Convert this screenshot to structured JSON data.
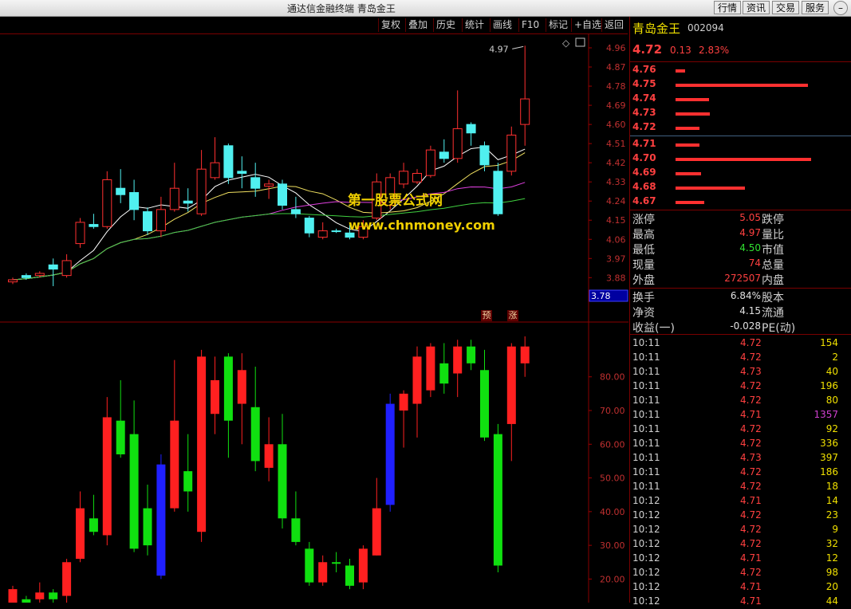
{
  "window": {
    "title": "通达信金融终端  青岛金王",
    "buttons": [
      "行情",
      "资讯",
      "交易",
      "服务"
    ]
  },
  "toolbar": {
    "items": [
      "复权",
      "叠加",
      "历史",
      "统计",
      "画线",
      "F10",
      "标记",
      "+自选",
      "返回"
    ]
  },
  "chart_data": [
    {
      "type": "candlestick",
      "ylabels": [
        "4.96",
        "4.87",
        "4.78",
        "4.69",
        "4.60",
        "4.51",
        "4.42",
        "4.33",
        "4.24",
        "4.15",
        "4.06",
        "3.97",
        "3.88"
      ],
      "ylim": [
        3.78,
        4.99
      ],
      "current_price_label": "3.78",
      "high_annotation": "4.97",
      "candles": [
        {
          "o": 3.86,
          "c": 3.87,
          "h": 3.88,
          "l": 3.85,
          "up": true
        },
        {
          "o": 3.89,
          "c": 3.88,
          "h": 3.9,
          "l": 3.87,
          "up": false
        },
        {
          "o": 3.89,
          "c": 3.9,
          "h": 3.91,
          "l": 3.88,
          "up": true
        },
        {
          "o": 3.94,
          "c": 3.92,
          "h": 3.97,
          "l": 3.84,
          "up": false
        },
        {
          "o": 3.89,
          "c": 3.96,
          "h": 3.99,
          "l": 3.88,
          "up": true
        },
        {
          "o": 4.04,
          "c": 4.14,
          "h": 4.16,
          "l": 4.02,
          "up": true
        },
        {
          "o": 4.13,
          "c": 4.12,
          "h": 4.18,
          "l": 4.11,
          "up": false
        },
        {
          "o": 4.12,
          "c": 4.34,
          "h": 4.38,
          "l": 4.11,
          "up": true
        },
        {
          "o": 4.3,
          "c": 4.27,
          "h": 4.39,
          "l": 4.23,
          "up": false
        },
        {
          "o": 4.28,
          "c": 4.2,
          "h": 4.34,
          "l": 4.15,
          "up": false
        },
        {
          "o": 4.19,
          "c": 4.1,
          "h": 4.21,
          "l": 4.08,
          "up": false
        },
        {
          "o": 4.1,
          "c": 4.2,
          "h": 4.26,
          "l": 4.07,
          "up": true
        },
        {
          "o": 4.2,
          "c": 4.3,
          "h": 4.42,
          "l": 4.19,
          "up": true
        },
        {
          "o": 4.24,
          "c": 4.23,
          "h": 4.3,
          "l": 4.19,
          "up": false
        },
        {
          "o": 4.18,
          "c": 4.39,
          "h": 4.48,
          "l": 4.17,
          "up": true
        },
        {
          "o": 4.35,
          "c": 4.42,
          "h": 4.54,
          "l": 4.34,
          "up": true
        },
        {
          "o": 4.5,
          "c": 4.35,
          "h": 4.51,
          "l": 4.32,
          "up": false
        },
        {
          "o": 4.38,
          "c": 4.37,
          "h": 4.45,
          "l": 4.3,
          "up": false
        },
        {
          "o": 4.35,
          "c": 4.3,
          "h": 4.42,
          "l": 4.26,
          "up": false
        },
        {
          "o": 4.31,
          "c": 4.32,
          "h": 4.34,
          "l": 4.25,
          "up": true
        },
        {
          "o": 4.32,
          "c": 4.22,
          "h": 4.34,
          "l": 4.2,
          "up": false
        },
        {
          "o": 4.2,
          "c": 4.18,
          "h": 4.26,
          "l": 4.16,
          "up": false
        },
        {
          "o": 4.16,
          "c": 4.09,
          "h": 4.17,
          "l": 4.07,
          "up": false
        },
        {
          "o": 4.07,
          "c": 4.1,
          "h": 4.14,
          "l": 4.06,
          "up": true
        },
        {
          "o": 4.1,
          "c": 4.1,
          "h": 4.11,
          "l": 4.09,
          "up": false
        },
        {
          "o": 4.09,
          "c": 4.07,
          "h": 4.13,
          "l": 4.06,
          "up": false
        },
        {
          "o": 4.07,
          "c": 4.12,
          "h": 4.15,
          "l": 4.06,
          "up": true
        },
        {
          "o": 4.16,
          "c": 4.33,
          "h": 4.37,
          "l": 4.15,
          "up": true
        },
        {
          "o": 4.22,
          "c": 4.35,
          "h": 4.37,
          "l": 4.2,
          "up": true
        },
        {
          "o": 4.32,
          "c": 4.38,
          "h": 4.42,
          "l": 4.3,
          "up": true
        },
        {
          "o": 4.33,
          "c": 4.37,
          "h": 4.39,
          "l": 4.32,
          "up": true
        },
        {
          "o": 4.36,
          "c": 4.48,
          "h": 4.5,
          "l": 4.35,
          "up": true
        },
        {
          "o": 4.47,
          "c": 4.44,
          "h": 4.53,
          "l": 4.42,
          "up": false
        },
        {
          "o": 4.44,
          "c": 4.58,
          "h": 4.76,
          "l": 4.42,
          "up": true
        },
        {
          "o": 4.6,
          "c": 4.56,
          "h": 4.61,
          "l": 4.5,
          "up": false
        },
        {
          "o": 4.5,
          "c": 4.41,
          "h": 4.52,
          "l": 4.38,
          "up": false
        },
        {
          "o": 4.38,
          "c": 4.18,
          "h": 4.42,
          "l": 4.17,
          "up": false
        },
        {
          "o": 4.38,
          "c": 4.55,
          "h": 4.59,
          "l": 4.36,
          "up": true
        },
        {
          "o": 4.6,
          "c": 4.72,
          "h": 4.97,
          "l": 4.5,
          "up": true
        }
      ]
    },
    {
      "type": "bar",
      "ylabels": [
        "80.00",
        "70.00",
        "60.00",
        "50.00",
        "40.00",
        "30.00",
        "20.00"
      ],
      "ylim": [
        13,
        92
      ],
      "bars": [
        {
          "o": 13,
          "c": 17,
          "h": 18,
          "l": 12,
          "color": "red"
        },
        {
          "o": 14,
          "c": 13,
          "h": 15,
          "l": 12,
          "color": "green"
        },
        {
          "o": 14,
          "c": 16,
          "h": 19,
          "l": 13,
          "color": "red"
        },
        {
          "o": 16,
          "c": 14,
          "h": 17,
          "l": 13,
          "color": "green"
        },
        {
          "o": 15,
          "c": 25,
          "h": 26,
          "l": 13,
          "color": "red"
        },
        {
          "o": 26,
          "c": 41,
          "h": 46,
          "l": 25,
          "color": "red"
        },
        {
          "o": 38,
          "c": 34,
          "h": 45,
          "l": 33,
          "color": "green"
        },
        {
          "o": 33,
          "c": 68,
          "h": 74,
          "l": 30,
          "color": "red"
        },
        {
          "o": 67,
          "c": 57,
          "h": 79,
          "l": 56,
          "color": "green"
        },
        {
          "o": 63,
          "c": 29,
          "h": 73,
          "l": 28,
          "color": "green"
        },
        {
          "o": 41,
          "c": 30,
          "h": 48,
          "l": 27,
          "color": "green"
        },
        {
          "o": 54,
          "c": 21,
          "h": 57,
          "l": 20,
          "color": "blue"
        },
        {
          "o": 41,
          "c": 67,
          "h": 85,
          "l": 40,
          "color": "red"
        },
        {
          "o": 52,
          "c": 46,
          "h": 63,
          "l": 40,
          "color": "green"
        },
        {
          "o": 34,
          "c": 86,
          "h": 88,
          "l": 31,
          "color": "red"
        },
        {
          "o": 69,
          "c": 79,
          "h": 86,
          "l": 63,
          "color": "red"
        },
        {
          "o": 86,
          "c": 67,
          "h": 87,
          "l": 56,
          "color": "green"
        },
        {
          "o": 82,
          "c": 72,
          "h": 87,
          "l": 60,
          "color": "red"
        },
        {
          "o": 71,
          "c": 55,
          "h": 83,
          "l": 52,
          "color": "green"
        },
        {
          "o": 53,
          "c": 60,
          "h": 68,
          "l": 49,
          "color": "red"
        },
        {
          "o": 60,
          "c": 38,
          "h": 69,
          "l": 35,
          "color": "green"
        },
        {
          "o": 38,
          "c": 31,
          "h": 46,
          "l": 30,
          "color": "green"
        },
        {
          "o": 29,
          "c": 19,
          "h": 31,
          "l": 18,
          "color": "green"
        },
        {
          "o": 19,
          "c": 25,
          "h": 27,
          "l": 18,
          "color": "red"
        },
        {
          "o": 25,
          "c": 25,
          "h": 28,
          "l": 22,
          "color": "green"
        },
        {
          "o": 24,
          "c": 18,
          "h": 26,
          "l": 17,
          "color": "green"
        },
        {
          "o": 19,
          "c": 29,
          "h": 30,
          "l": 17,
          "color": "red"
        },
        {
          "o": 27,
          "c": 41,
          "h": 50,
          "l": 27,
          "color": "red"
        },
        {
          "o": 42,
          "c": 72,
          "h": 75,
          "l": 40,
          "color": "blue"
        },
        {
          "o": 70,
          "c": 75,
          "h": 76,
          "l": 59,
          "color": "red"
        },
        {
          "o": 72,
          "c": 86,
          "h": 89,
          "l": 62,
          "color": "red"
        },
        {
          "o": 76,
          "c": 89,
          "h": 90,
          "l": 74,
          "color": "red"
        },
        {
          "o": 84,
          "c": 78,
          "h": 90,
          "l": 75,
          "color": "green"
        },
        {
          "o": 81,
          "c": 89,
          "h": 91,
          "l": 74,
          "color": "red"
        },
        {
          "o": 89,
          "c": 84,
          "h": 91,
          "l": 82,
          "color": "green"
        },
        {
          "o": 82,
          "c": 62,
          "h": 88,
          "l": 61,
          "color": "green"
        },
        {
          "o": 63,
          "c": 24,
          "h": 66,
          "l": 22,
          "color": "green"
        },
        {
          "o": 66,
          "c": 89,
          "h": 90,
          "l": 55,
          "color": "red"
        },
        {
          "o": 89,
          "c": 84,
          "h": 92,
          "l": 80,
          "color": "red"
        }
      ]
    }
  ],
  "markers": {
    "yu": "预",
    "zhang": "涨"
  },
  "watermark": {
    "line1": "第一股票公式网",
    "line2": "www.chnmoney.com"
  },
  "quote": {
    "name": "青岛金王",
    "code": "002094",
    "price": "4.72",
    "change": "0.13",
    "change_pct": "2.83%"
  },
  "order_book": {
    "asks": [
      {
        "price": "4.76",
        "vol": 6
      },
      {
        "price": "4.75",
        "vol": 84
      },
      {
        "price": "4.74",
        "vol": 21
      },
      {
        "price": "4.73",
        "vol": 22
      },
      {
        "price": "4.72",
        "vol": 15
      }
    ],
    "bids": [
      {
        "price": "4.71",
        "vol": 15
      },
      {
        "price": "4.70",
        "vol": 86
      },
      {
        "price": "4.69",
        "vol": 16
      },
      {
        "price": "4.68",
        "vol": 44
      },
      {
        "price": "4.67",
        "vol": 18
      }
    ]
  },
  "stats": [
    {
      "label": "涨停",
      "value": "5.05",
      "color": "#ff4040",
      "label2": "跌停"
    },
    {
      "label": "最高",
      "value": "4.97",
      "color": "#ff4040",
      "label2": "量比"
    },
    {
      "label": "最低",
      "value": "4.50",
      "color": "#30e030",
      "label2": "市值"
    },
    {
      "label": "现量",
      "value": "74",
      "color": "#ff4040",
      "label2": "总量"
    },
    {
      "label": "外盘",
      "value": "272507",
      "color": "#ff4040",
      "label2": "内盘"
    },
    {
      "label": "换手",
      "value": "6.84%",
      "color": "#e0e0e0",
      "label2": "股本"
    },
    {
      "label": "净资",
      "value": "4.15",
      "color": "#e0e0e0",
      "label2": "流通"
    },
    {
      "label": "收益(一)",
      "value": "-0.028",
      "color": "#e0e0e0",
      "label2": "PE(动)"
    }
  ],
  "ticks": [
    {
      "time": "10:11",
      "price": "4.72",
      "vol": "154",
      "pcolor": "#ff4040",
      "vcolor": "#f0e000"
    },
    {
      "time": "10:11",
      "price": "4.72",
      "vol": "2",
      "pcolor": "#ff4040",
      "vcolor": "#f0e000"
    },
    {
      "time": "10:11",
      "price": "4.73",
      "vol": "40",
      "pcolor": "#ff4040",
      "vcolor": "#f0e000"
    },
    {
      "time": "10:11",
      "price": "4.72",
      "vol": "196",
      "pcolor": "#ff4040",
      "vcolor": "#f0e000"
    },
    {
      "time": "10:11",
      "price": "4.72",
      "vol": "80",
      "pcolor": "#ff4040",
      "vcolor": "#f0e000"
    },
    {
      "time": "10:11",
      "price": "4.71",
      "vol": "1357",
      "pcolor": "#ff4040",
      "vcolor": "#d040d0"
    },
    {
      "time": "10:11",
      "price": "4.72",
      "vol": "92",
      "pcolor": "#ff4040",
      "vcolor": "#f0e000"
    },
    {
      "time": "10:11",
      "price": "4.72",
      "vol": "336",
      "pcolor": "#ff4040",
      "vcolor": "#f0e000"
    },
    {
      "time": "10:11",
      "price": "4.73",
      "vol": "397",
      "pcolor": "#ff4040",
      "vcolor": "#f0e000"
    },
    {
      "time": "10:11",
      "price": "4.72",
      "vol": "186",
      "pcolor": "#ff4040",
      "vcolor": "#f0e000"
    },
    {
      "time": "10:11",
      "price": "4.72",
      "vol": "18",
      "pcolor": "#ff4040",
      "vcolor": "#f0e000"
    },
    {
      "time": "10:12",
      "price": "4.71",
      "vol": "14",
      "pcolor": "#ff4040",
      "vcolor": "#f0e000"
    },
    {
      "time": "10:12",
      "price": "4.72",
      "vol": "23",
      "pcolor": "#ff4040",
      "vcolor": "#f0e000"
    },
    {
      "time": "10:12",
      "price": "4.72",
      "vol": "9",
      "pcolor": "#ff4040",
      "vcolor": "#f0e000"
    },
    {
      "time": "10:12",
      "price": "4.72",
      "vol": "32",
      "pcolor": "#ff4040",
      "vcolor": "#f0e000"
    },
    {
      "time": "10:12",
      "price": "4.71",
      "vol": "12",
      "pcolor": "#ff4040",
      "vcolor": "#f0e000"
    },
    {
      "time": "10:12",
      "price": "4.72",
      "vol": "98",
      "pcolor": "#ff4040",
      "vcolor": "#f0e000"
    },
    {
      "time": "10:12",
      "price": "4.71",
      "vol": "20",
      "pcolor": "#ff4040",
      "vcolor": "#f0e000"
    },
    {
      "time": "10:12",
      "price": "4.71",
      "vol": "44",
      "pcolor": "#ff4040",
      "vcolor": "#f0e000"
    }
  ]
}
